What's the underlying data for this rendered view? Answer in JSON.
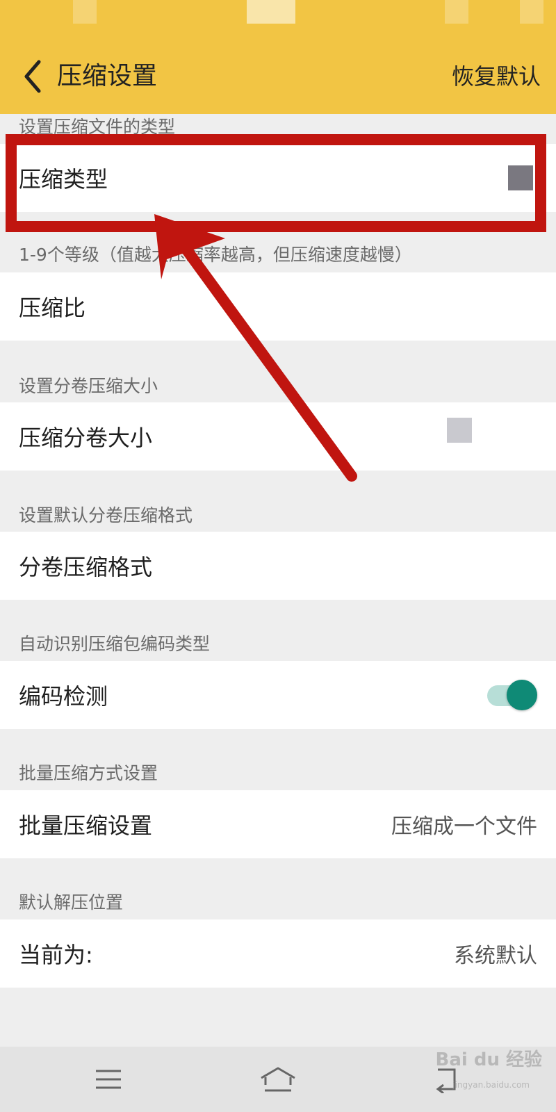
{
  "header": {
    "title": "压缩设置",
    "restore_label": "恢复默认",
    "color": "#f2c544"
  },
  "sections": [
    {
      "label": "设置压缩文件的类型",
      "row": {
        "label": "压缩类型",
        "value": ""
      }
    },
    {
      "label": "1-9个等级（值越大压缩率越高，但压缩速度越慢）",
      "row": {
        "label": "压缩比",
        "value": ""
      }
    },
    {
      "label": "设置分卷压缩大小",
      "row": {
        "label": "压缩分卷大小",
        "value": ""
      }
    },
    {
      "label": "设置默认分卷压缩格式",
      "row": {
        "label": "分卷压缩格式",
        "value": ""
      }
    },
    {
      "label": "自动识别压缩包编码类型",
      "row": {
        "label": "编码检测",
        "toggle_on": true
      }
    },
    {
      "label": "批量压缩方式设置",
      "row": {
        "label": "批量压缩设置",
        "value": "压缩成一个文件"
      }
    },
    {
      "label": "默认解压位置",
      "row": {
        "label": "当前为:",
        "value": "系统默认"
      }
    }
  ],
  "icons": {
    "back": "chevron-left-icon",
    "menu": "menu-icon",
    "home": "home-icon",
    "back_nav": "back-nav-icon"
  },
  "watermark": {
    "brand": "Bai du 经验",
    "url": "jingyan.baidu.com"
  },
  "colors": {
    "toggle_on": "#0f8a76",
    "annotation": "#c0150f"
  }
}
